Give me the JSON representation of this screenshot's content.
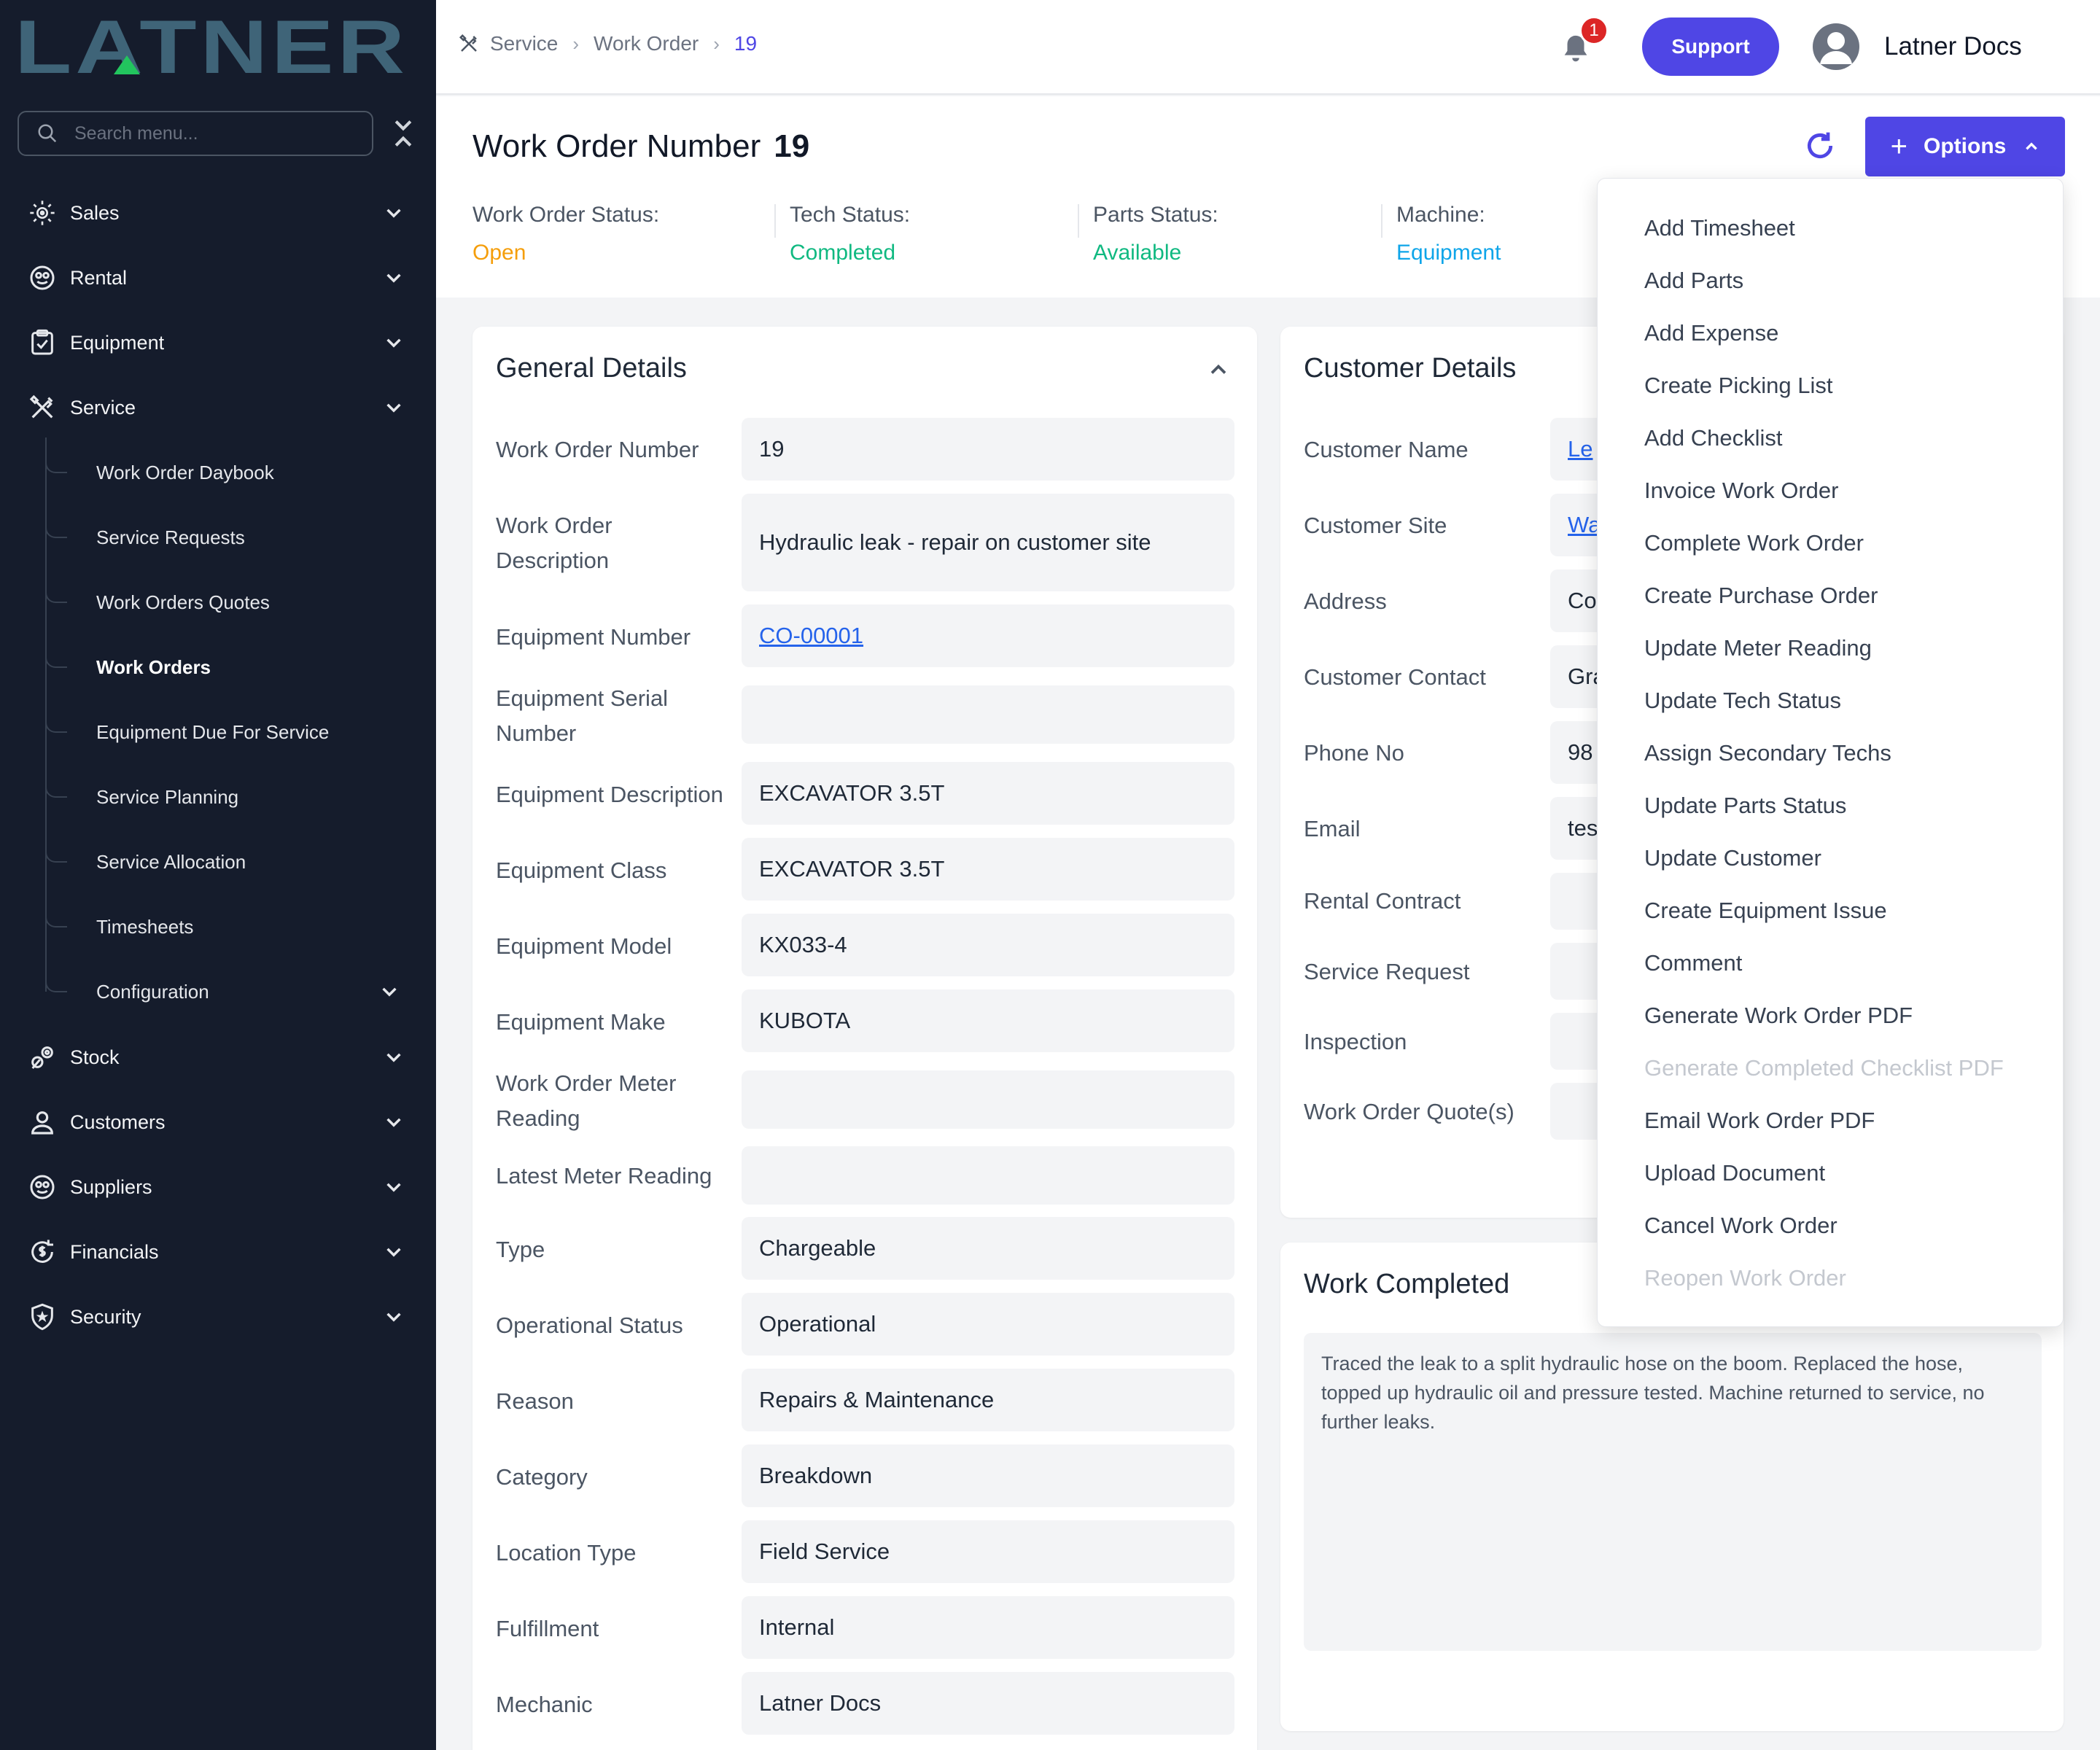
{
  "brand": {
    "logo_text": "LATNER"
  },
  "search": {
    "placeholder": "Search menu..."
  },
  "sidebar": {
    "items": [
      {
        "label": "Sales",
        "icon": "sales-icon"
      },
      {
        "label": "Rental",
        "icon": "rental-icon"
      },
      {
        "label": "Equipment",
        "icon": "equipment-icon"
      },
      {
        "label": "Service",
        "icon": "service-icon"
      },
      {
        "label": "Stock",
        "icon": "stock-icon"
      },
      {
        "label": "Customers",
        "icon": "user-icon"
      },
      {
        "label": "Suppliers",
        "icon": "suppliers-icon"
      },
      {
        "label": "Financials",
        "icon": "financials-icon"
      },
      {
        "label": "Security",
        "icon": "shield-icon"
      }
    ],
    "service_sub": [
      {
        "label": "Work Order Daybook"
      },
      {
        "label": "Service Requests"
      },
      {
        "label": "Work Orders Quotes"
      },
      {
        "label": "Work Orders",
        "active": true
      },
      {
        "label": "Equipment Due For Service"
      },
      {
        "label": "Service Planning"
      },
      {
        "label": "Service Allocation"
      },
      {
        "label": "Timesheets"
      },
      {
        "label": "Configuration"
      }
    ]
  },
  "breadcrumb": [
    "Service",
    "Work Order",
    "19"
  ],
  "header": {
    "notification_count": "1",
    "support_label": "Support",
    "user_name": "Latner Docs"
  },
  "title": {
    "label": "Work Order Number",
    "number": "19"
  },
  "options": {
    "label": "Options"
  },
  "statuses": [
    {
      "label": "Work Order Status:",
      "value": "Open",
      "color": "#f59e0b"
    },
    {
      "label": "Tech Status:",
      "value": "Completed",
      "color": "#10b981"
    },
    {
      "label": "Parts Status:",
      "value": "Available",
      "color": "#10b981"
    },
    {
      "label": "Machine:",
      "value": "Equipment",
      "color": "#0ea5e9"
    }
  ],
  "general": {
    "title": "General Details",
    "rows": [
      {
        "label": "Work Order Number",
        "value": "19"
      },
      {
        "label": "Work Order Description",
        "value": "Hydraulic leak - repair on customer site"
      },
      {
        "label": "Equipment Number",
        "value": "CO-00001"
      },
      {
        "label": "Equipment Serial Number",
        "value": ""
      },
      {
        "label": "Equipment Description",
        "value": "EXCAVATOR 3.5T"
      },
      {
        "label": "Equipment Class",
        "value": "EXCAVATOR 3.5T"
      },
      {
        "label": "Equipment Model",
        "value": "KX033-4"
      },
      {
        "label": "Equipment Make",
        "value": "KUBOTA"
      },
      {
        "label": "Work Order Meter Reading",
        "value": ""
      },
      {
        "label": "Latest Meter Reading",
        "value": ""
      },
      {
        "label": "Type",
        "value": "Chargeable"
      },
      {
        "label": "Operational Status",
        "value": "Operational"
      },
      {
        "label": "Reason",
        "value": "Repairs & Maintenance"
      },
      {
        "label": "Category",
        "value": "Breakdown"
      },
      {
        "label": "Location Type",
        "value": "Field Service"
      },
      {
        "label": "Fulfillment",
        "value": "Internal"
      },
      {
        "label": "Mechanic",
        "value": "Latner Docs"
      }
    ]
  },
  "customer": {
    "title": "Customer Details",
    "rows": [
      {
        "label": "Customer Name",
        "value": "Le"
      },
      {
        "label": "Customer Site",
        "value": "Wa"
      },
      {
        "label": "Address",
        "value": "Co"
      },
      {
        "label": "Customer Contact",
        "value": "Gra"
      },
      {
        "label": "Phone No",
        "value": "98"
      },
      {
        "label": "Email",
        "value": "tes"
      },
      {
        "label": "Rental Contract",
        "value": ""
      },
      {
        "label": "Service Request",
        "value": ""
      },
      {
        "label": "Inspection",
        "value": ""
      },
      {
        "label": "Work Order Quote(s)",
        "value": ""
      }
    ]
  },
  "work_completed": {
    "title": "Work Completed",
    "text": "Traced the leak to a split hydraulic hose on the boom. Replaced the hose, topped up hydraulic oil and pressure tested. Machine returned to service, no further leaks."
  },
  "dropdown": {
    "items": [
      {
        "label": "Add Timesheet",
        "disabled": false
      },
      {
        "label": "Add Parts",
        "disabled": false
      },
      {
        "label": "Add Expense",
        "disabled": false
      },
      {
        "label": "Create Picking List",
        "disabled": false
      },
      {
        "label": "Add Checklist",
        "disabled": false
      },
      {
        "label": "Invoice Work Order",
        "disabled": false
      },
      {
        "label": "Complete Work Order",
        "disabled": false
      },
      {
        "label": "Create Purchase Order",
        "disabled": false
      },
      {
        "label": "Update Meter Reading",
        "disabled": false
      },
      {
        "label": "Update Tech Status",
        "disabled": false
      },
      {
        "label": "Assign Secondary Techs",
        "disabled": false
      },
      {
        "label": "Update Parts Status",
        "disabled": false
      },
      {
        "label": "Update Customer",
        "disabled": false
      },
      {
        "label": "Create Equipment Issue",
        "disabled": false
      },
      {
        "label": "Comment",
        "disabled": false
      },
      {
        "label": "Generate Work Order PDF",
        "disabled": false
      },
      {
        "label": "Generate Completed Checklist PDF",
        "disabled": true
      },
      {
        "label": "Email Work Order PDF",
        "disabled": false
      },
      {
        "label": "Upload Document",
        "disabled": false
      },
      {
        "label": "Cancel Work Order",
        "disabled": false
      },
      {
        "label": "Reopen Work Order",
        "disabled": true
      }
    ]
  },
  "colors": {
    "accent": "#4f46e5",
    "sidebar_bg": "#151c2c",
    "link": "#2563eb"
  }
}
